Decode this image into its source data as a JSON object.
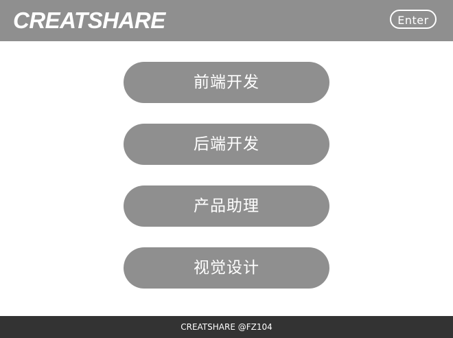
{
  "header": {
    "logo_text": "CREATSHARE",
    "enter_label": "Enter"
  },
  "menu": {
    "items": [
      {
        "label": "前端开发"
      },
      {
        "label": "后端开发"
      },
      {
        "label": "产品助理"
      },
      {
        "label": "视觉设计"
      }
    ]
  },
  "footer": {
    "text": "CREATSHARE @FZ104"
  },
  "colors": {
    "header_bg": "#8f8f8f",
    "button_bg": "#8f8f8f",
    "footer_bg": "#333333",
    "text": "#ffffff",
    "page_bg": "#ffffff"
  }
}
